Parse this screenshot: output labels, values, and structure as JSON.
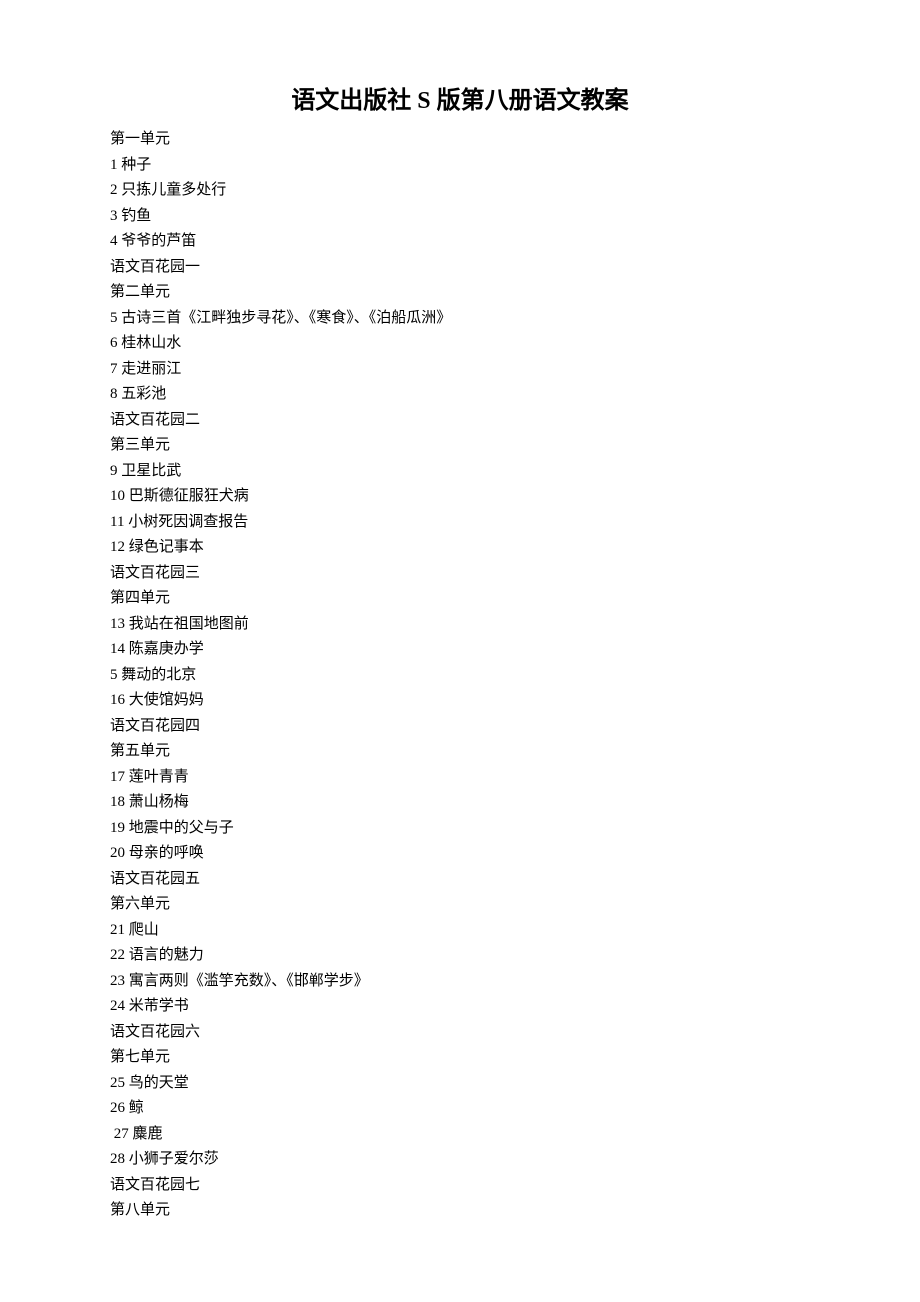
{
  "title": "语文出版社 S 版第八册语文教案",
  "units": [
    {
      "heading": "第一单元",
      "items": [
        "1 种子",
        "2 只拣儿童多处行",
        "3 钓鱼",
        "4 爷爷的芦笛",
        "语文百花园一"
      ]
    },
    {
      "heading": "第二单元",
      "items": [
        "5 古诗三首《江畔独步寻花》、《寒食》、《泊船瓜洲》",
        "6 桂林山水",
        "7 走进丽江",
        "8 五彩池",
        "语文百花园二"
      ]
    },
    {
      "heading": "第三单元",
      "items": [
        "9 卫星比武",
        "10 巴斯德征服狂犬病",
        "11 小树死因调查报告",
        "12 绿色记事本",
        "语文百花园三"
      ]
    },
    {
      "heading": "第四单元",
      "items": [
        "13 我站在祖国地图前",
        "14 陈嘉庚办学",
        "5 舞动的北京",
        "16 大使馆妈妈",
        "语文百花园四"
      ]
    },
    {
      "heading": "第五单元",
      "items": [
        "17 莲叶青青",
        "18 萧山杨梅",
        "19 地震中的父与子",
        "20 母亲的呼唤",
        "语文百花园五"
      ]
    },
    {
      "heading": "第六单元",
      "items": [
        "21 爬山",
        "22 语言的魅力",
        "23 寓言两则《滥竽充数》、《邯郸学步》",
        "24 米芾学书",
        "语文百花园六"
      ]
    },
    {
      "heading": "第七单元",
      "items": [
        "25 鸟的天堂",
        "26 鲸",
        " 27 麋鹿",
        "28 小狮子爱尔莎",
        "语文百花园七"
      ]
    },
    {
      "heading": "第八单元",
      "items": []
    }
  ]
}
